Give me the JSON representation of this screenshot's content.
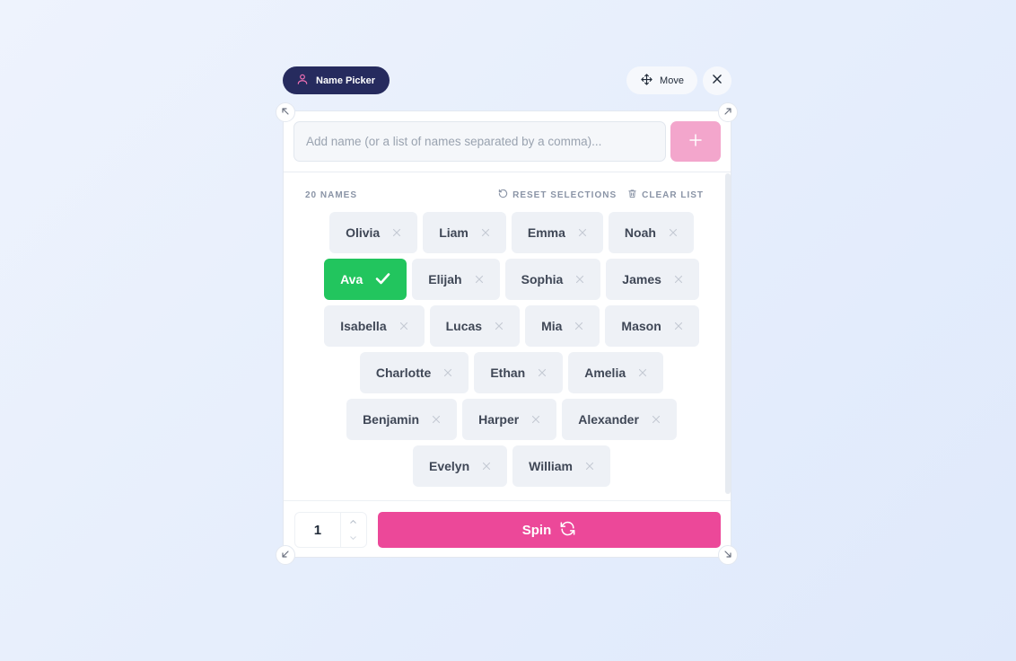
{
  "widget": {
    "title": "Name Picker",
    "move_label": "Move"
  },
  "input": {
    "placeholder": "Add name (or a list of names separated by a comma)..."
  },
  "list": {
    "count_label": "20 NAMES",
    "reset_label": "RESET SELECTIONS",
    "clear_label": "CLEAR LIST",
    "names": [
      {
        "label": "Olivia",
        "selected": false
      },
      {
        "label": "Liam",
        "selected": false
      },
      {
        "label": "Emma",
        "selected": false
      },
      {
        "label": "Noah",
        "selected": false
      },
      {
        "label": "Ava",
        "selected": true
      },
      {
        "label": "Elijah",
        "selected": false
      },
      {
        "label": "Sophia",
        "selected": false
      },
      {
        "label": "James",
        "selected": false
      },
      {
        "label": "Isabella",
        "selected": false
      },
      {
        "label": "Lucas",
        "selected": false
      },
      {
        "label": "Mia",
        "selected": false
      },
      {
        "label": "Mason",
        "selected": false
      },
      {
        "label": "Charlotte",
        "selected": false
      },
      {
        "label": "Ethan",
        "selected": false
      },
      {
        "label": "Amelia",
        "selected": false
      },
      {
        "label": "Benjamin",
        "selected": false
      },
      {
        "label": "Harper",
        "selected": false
      },
      {
        "label": "Alexander",
        "selected": false
      },
      {
        "label": "Evelyn",
        "selected": false
      },
      {
        "label": "William",
        "selected": false
      }
    ]
  },
  "footer": {
    "quantity": "1",
    "spin_label": "Spin"
  },
  "icons": {
    "title": "user-icon",
    "move": "move-arrows-icon",
    "close": "close-icon",
    "add": "plus-icon",
    "reset": "rotate-ccw-icon",
    "clear": "trash-icon",
    "remove": "x-icon",
    "selected": "check-icon",
    "spin": "refresh-icon",
    "corner": "resize-arrow-icon"
  },
  "colors": {
    "title_bg": "#262b5e",
    "title_icon": "#f472b6",
    "add_button": "#f3a6cc",
    "selected_chip": "#22c55e",
    "spin_button": "#ec4899"
  }
}
